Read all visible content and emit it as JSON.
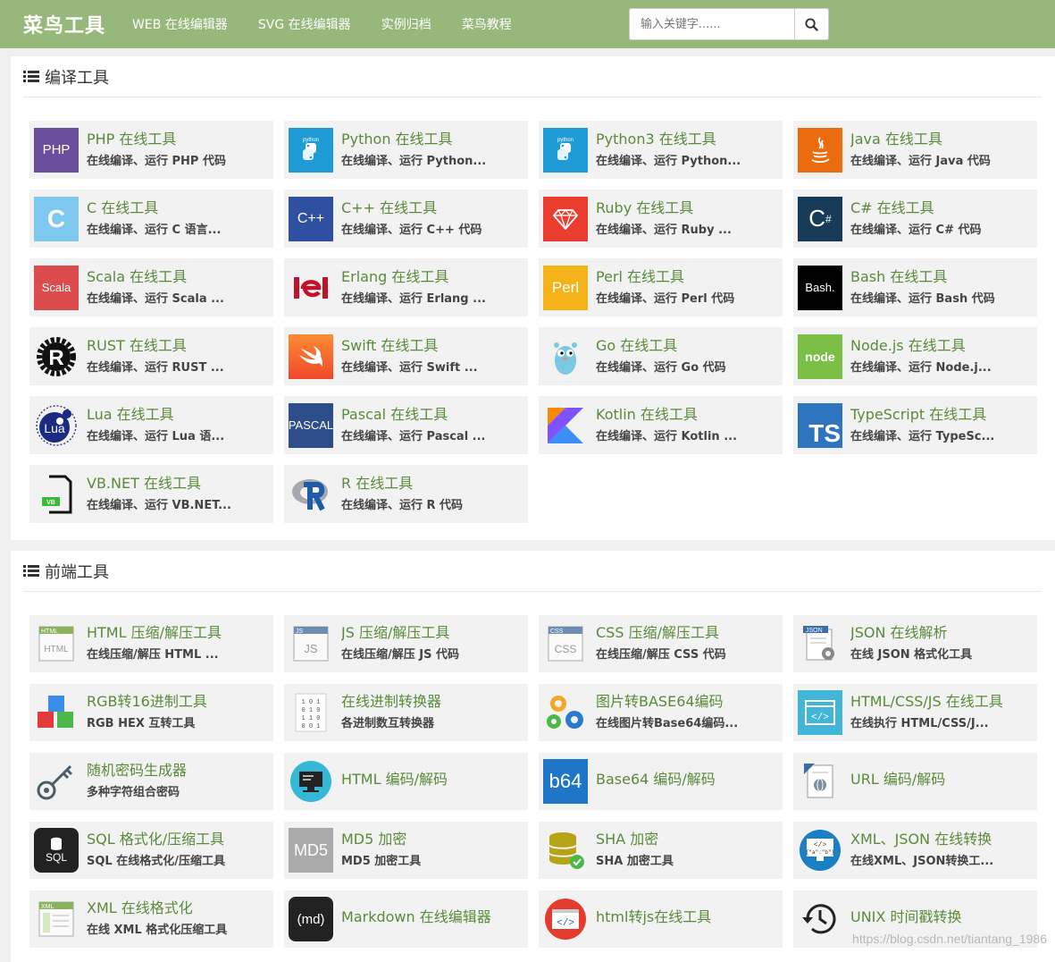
{
  "header": {
    "brand": "菜鸟工具",
    "nav": [
      "WEB 在线编辑器",
      "SVG 在线编辑器",
      "实例归档",
      "菜鸟教程"
    ],
    "search_placeholder": "输入关键字......",
    "bg_color": "#96b97b"
  },
  "compile_tools": {
    "title": "编译工具",
    "items": [
      {
        "title": "PHP 在线工具",
        "desc": "在线编译、运行 PHP 代码",
        "icon": "php-icon"
      },
      {
        "title": "Python 在线工具",
        "desc": "在线编译、运行 Python...",
        "icon": "python-icon"
      },
      {
        "title": "Python3 在线工具",
        "desc": "在线编译、运行 Python...",
        "icon": "python3-icon"
      },
      {
        "title": "Java 在线工具",
        "desc": "在线编译、运行 Java 代码",
        "icon": "java-icon"
      },
      {
        "title": "C 在线工具",
        "desc": "在线编译、运行 C 语言...",
        "icon": "c-icon"
      },
      {
        "title": "C++ 在线工具",
        "desc": "在线编译、运行 C++ 代码",
        "icon": "cpp-icon"
      },
      {
        "title": "Ruby 在线工具",
        "desc": "在线编译、运行 Ruby ...",
        "icon": "ruby-icon"
      },
      {
        "title": "C# 在线工具",
        "desc": "在线编译、运行 C# 代码",
        "icon": "csharp-icon"
      },
      {
        "title": "Scala 在线工具",
        "desc": "在线编译、运行 Scala ...",
        "icon": "scala-icon"
      },
      {
        "title": "Erlang 在线工具",
        "desc": "在线编译、运行 Erlang ...",
        "icon": "erlang-icon"
      },
      {
        "title": "Perl 在线工具",
        "desc": "在线编译、运行 Perl 代码",
        "icon": "perl-icon"
      },
      {
        "title": "Bash 在线工具",
        "desc": "在线编译、运行 Bash 代码",
        "icon": "bash-icon"
      },
      {
        "title": "RUST 在线工具",
        "desc": "在线编译、运行 RUST ...",
        "icon": "rust-icon"
      },
      {
        "title": "Swift 在线工具",
        "desc": "在线编译、运行 Swift ...",
        "icon": "swift-icon"
      },
      {
        "title": "Go 在线工具",
        "desc": "在线编译、运行 Go 代码",
        "icon": "go-icon"
      },
      {
        "title": "Node.js 在线工具",
        "desc": "在线编译、运行 Node.j...",
        "icon": "nodejs-icon"
      },
      {
        "title": "Lua 在线工具",
        "desc": "在线编译、运行 Lua 语...",
        "icon": "lua-icon"
      },
      {
        "title": "Pascal 在线工具",
        "desc": "在线编译、运行 Pascal ...",
        "icon": "pascal-icon"
      },
      {
        "title": "Kotlin 在线工具",
        "desc": "在线编译、运行 Kotlin ...",
        "icon": "kotlin-icon"
      },
      {
        "title": "TypeScript 在线工具",
        "desc": "在线编译、运行 TypeSc...",
        "icon": "typescript-icon"
      },
      {
        "title": "VB.NET 在线工具",
        "desc": "在线编译、运行 VB.NET...",
        "icon": "vbnet-icon"
      },
      {
        "title": "R 在线工具",
        "desc": "在线编译、运行 R 代码",
        "icon": "r-icon"
      }
    ]
  },
  "frontend_tools": {
    "title": "前端工具",
    "items": [
      {
        "title": "HTML 压缩/解压工具",
        "desc": "在线压缩/解压 HTML ...",
        "icon": "html-compress-icon"
      },
      {
        "title": "JS 压缩/解压工具",
        "desc": "在线压缩/解压 JS 代码",
        "icon": "js-compress-icon"
      },
      {
        "title": "CSS 压缩/解压工具",
        "desc": "在线压缩/解压 CSS 代码",
        "icon": "css-compress-icon"
      },
      {
        "title": "JSON 在线解析",
        "desc": "在线 JSON 格式化工具",
        "icon": "json-icon"
      },
      {
        "title": "RGB转16进制工具",
        "desc": "RGB HEX 互转工具",
        "icon": "rgb-cubes-icon"
      },
      {
        "title": "在线进制转换器",
        "desc": "各进制数互转换器",
        "icon": "binary-icon"
      },
      {
        "title": "图片转BASE64编码",
        "desc": "在线图片转Base64编码...",
        "icon": "gears-icon"
      },
      {
        "title": "HTML/CSS/JS 在线工具",
        "desc": "在线执行 HTML/CSS/J...",
        "icon": "code-window-icon"
      },
      {
        "title": "随机密码生成器",
        "desc": "多种字符组合密码",
        "icon": "key-icon"
      },
      {
        "title": "HTML 编码/解码",
        "desc": "",
        "icon": "monitor-icon"
      },
      {
        "title": "Base64 编码/解码",
        "desc": "",
        "icon": "b64-icon"
      },
      {
        "title": "URL 编码/解码",
        "desc": "",
        "icon": "url-doc-icon"
      },
      {
        "title": "SQL 格式化/压缩工具",
        "desc": "SQL 在线格式化/压缩工具",
        "icon": "sql-icon"
      },
      {
        "title": "MD5 加密",
        "desc": "MD5 加密工具",
        "icon": "md5-icon"
      },
      {
        "title": "SHA 加密",
        "desc": "SHA 加密工具",
        "icon": "database-icon"
      },
      {
        "title": "XML、JSON 在线转换",
        "desc": "在线XML、JSON转换工...",
        "icon": "xml-json-icon"
      },
      {
        "title": "XML 在线格式化",
        "desc": "在线 XML 格式化压缩工具",
        "icon": "xml-icon"
      },
      {
        "title": "Markdown 在线编辑器",
        "desc": "",
        "icon": "markdown-icon"
      },
      {
        "title": "html转js在线工具",
        "desc": "",
        "icon": "html-js-icon"
      },
      {
        "title": "UNIX 时间戳转换",
        "desc": "",
        "icon": "history-clock-icon"
      }
    ]
  },
  "watermark": "https://blog.csdn.net/tiantang_1986"
}
